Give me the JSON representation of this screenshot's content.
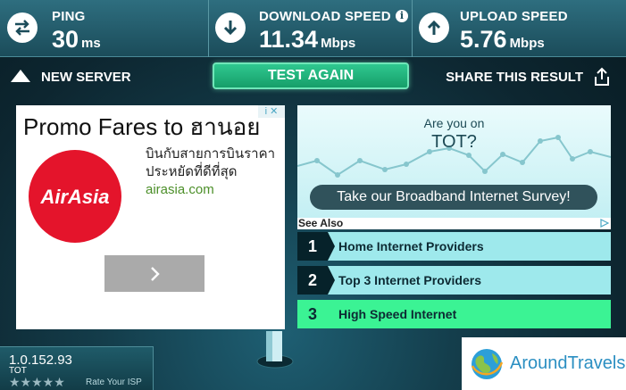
{
  "stats": {
    "ping": {
      "label": "PING",
      "value": "30",
      "unit": "ms",
      "icon": "ping-arrows-icon"
    },
    "download": {
      "label": "DOWNLOAD SPEED",
      "value": "11.34",
      "unit": "Mbps",
      "icon": "download-arrow-icon",
      "info": "i"
    },
    "upload": {
      "label": "UPLOAD SPEED",
      "value": "5.76",
      "unit": "Mbps",
      "icon": "upload-arrow-icon"
    }
  },
  "actions": {
    "new_server": "NEW SERVER",
    "test_again": "TEST AGAIN",
    "share": "SHARE THIS RESULT"
  },
  "ad": {
    "title": "Promo Fares to ฮานอย",
    "badge": "i ✕",
    "brand": "AirAsia",
    "line1": "บินกับสายการบินราคา",
    "line2": "ประหยัดที่ดีที่สุด",
    "url": "airasia.com",
    "next": "›"
  },
  "survey": {
    "question1": "Are you on",
    "question2": "TOT?",
    "cta": "Take our Broadband Internet Survey!"
  },
  "see_also": {
    "label": "See Also",
    "items": [
      {
        "num": "1",
        "text": "Home Internet Providers"
      },
      {
        "num": "2",
        "text": "Top 3 Internet Providers"
      },
      {
        "num": "3",
        "text": "High Speed Internet"
      }
    ]
  },
  "connection": {
    "ip": "1.0.152.93",
    "isp": "TOT",
    "stars": "★★★★★",
    "rate_label": "Rate Your ISP"
  },
  "watermark": {
    "text": "AroundTravels"
  },
  "colors": {
    "accent": "#169e69",
    "highlight": "#3bf394",
    "panel": "#9ee9ec",
    "brand_red": "#e4142b"
  }
}
